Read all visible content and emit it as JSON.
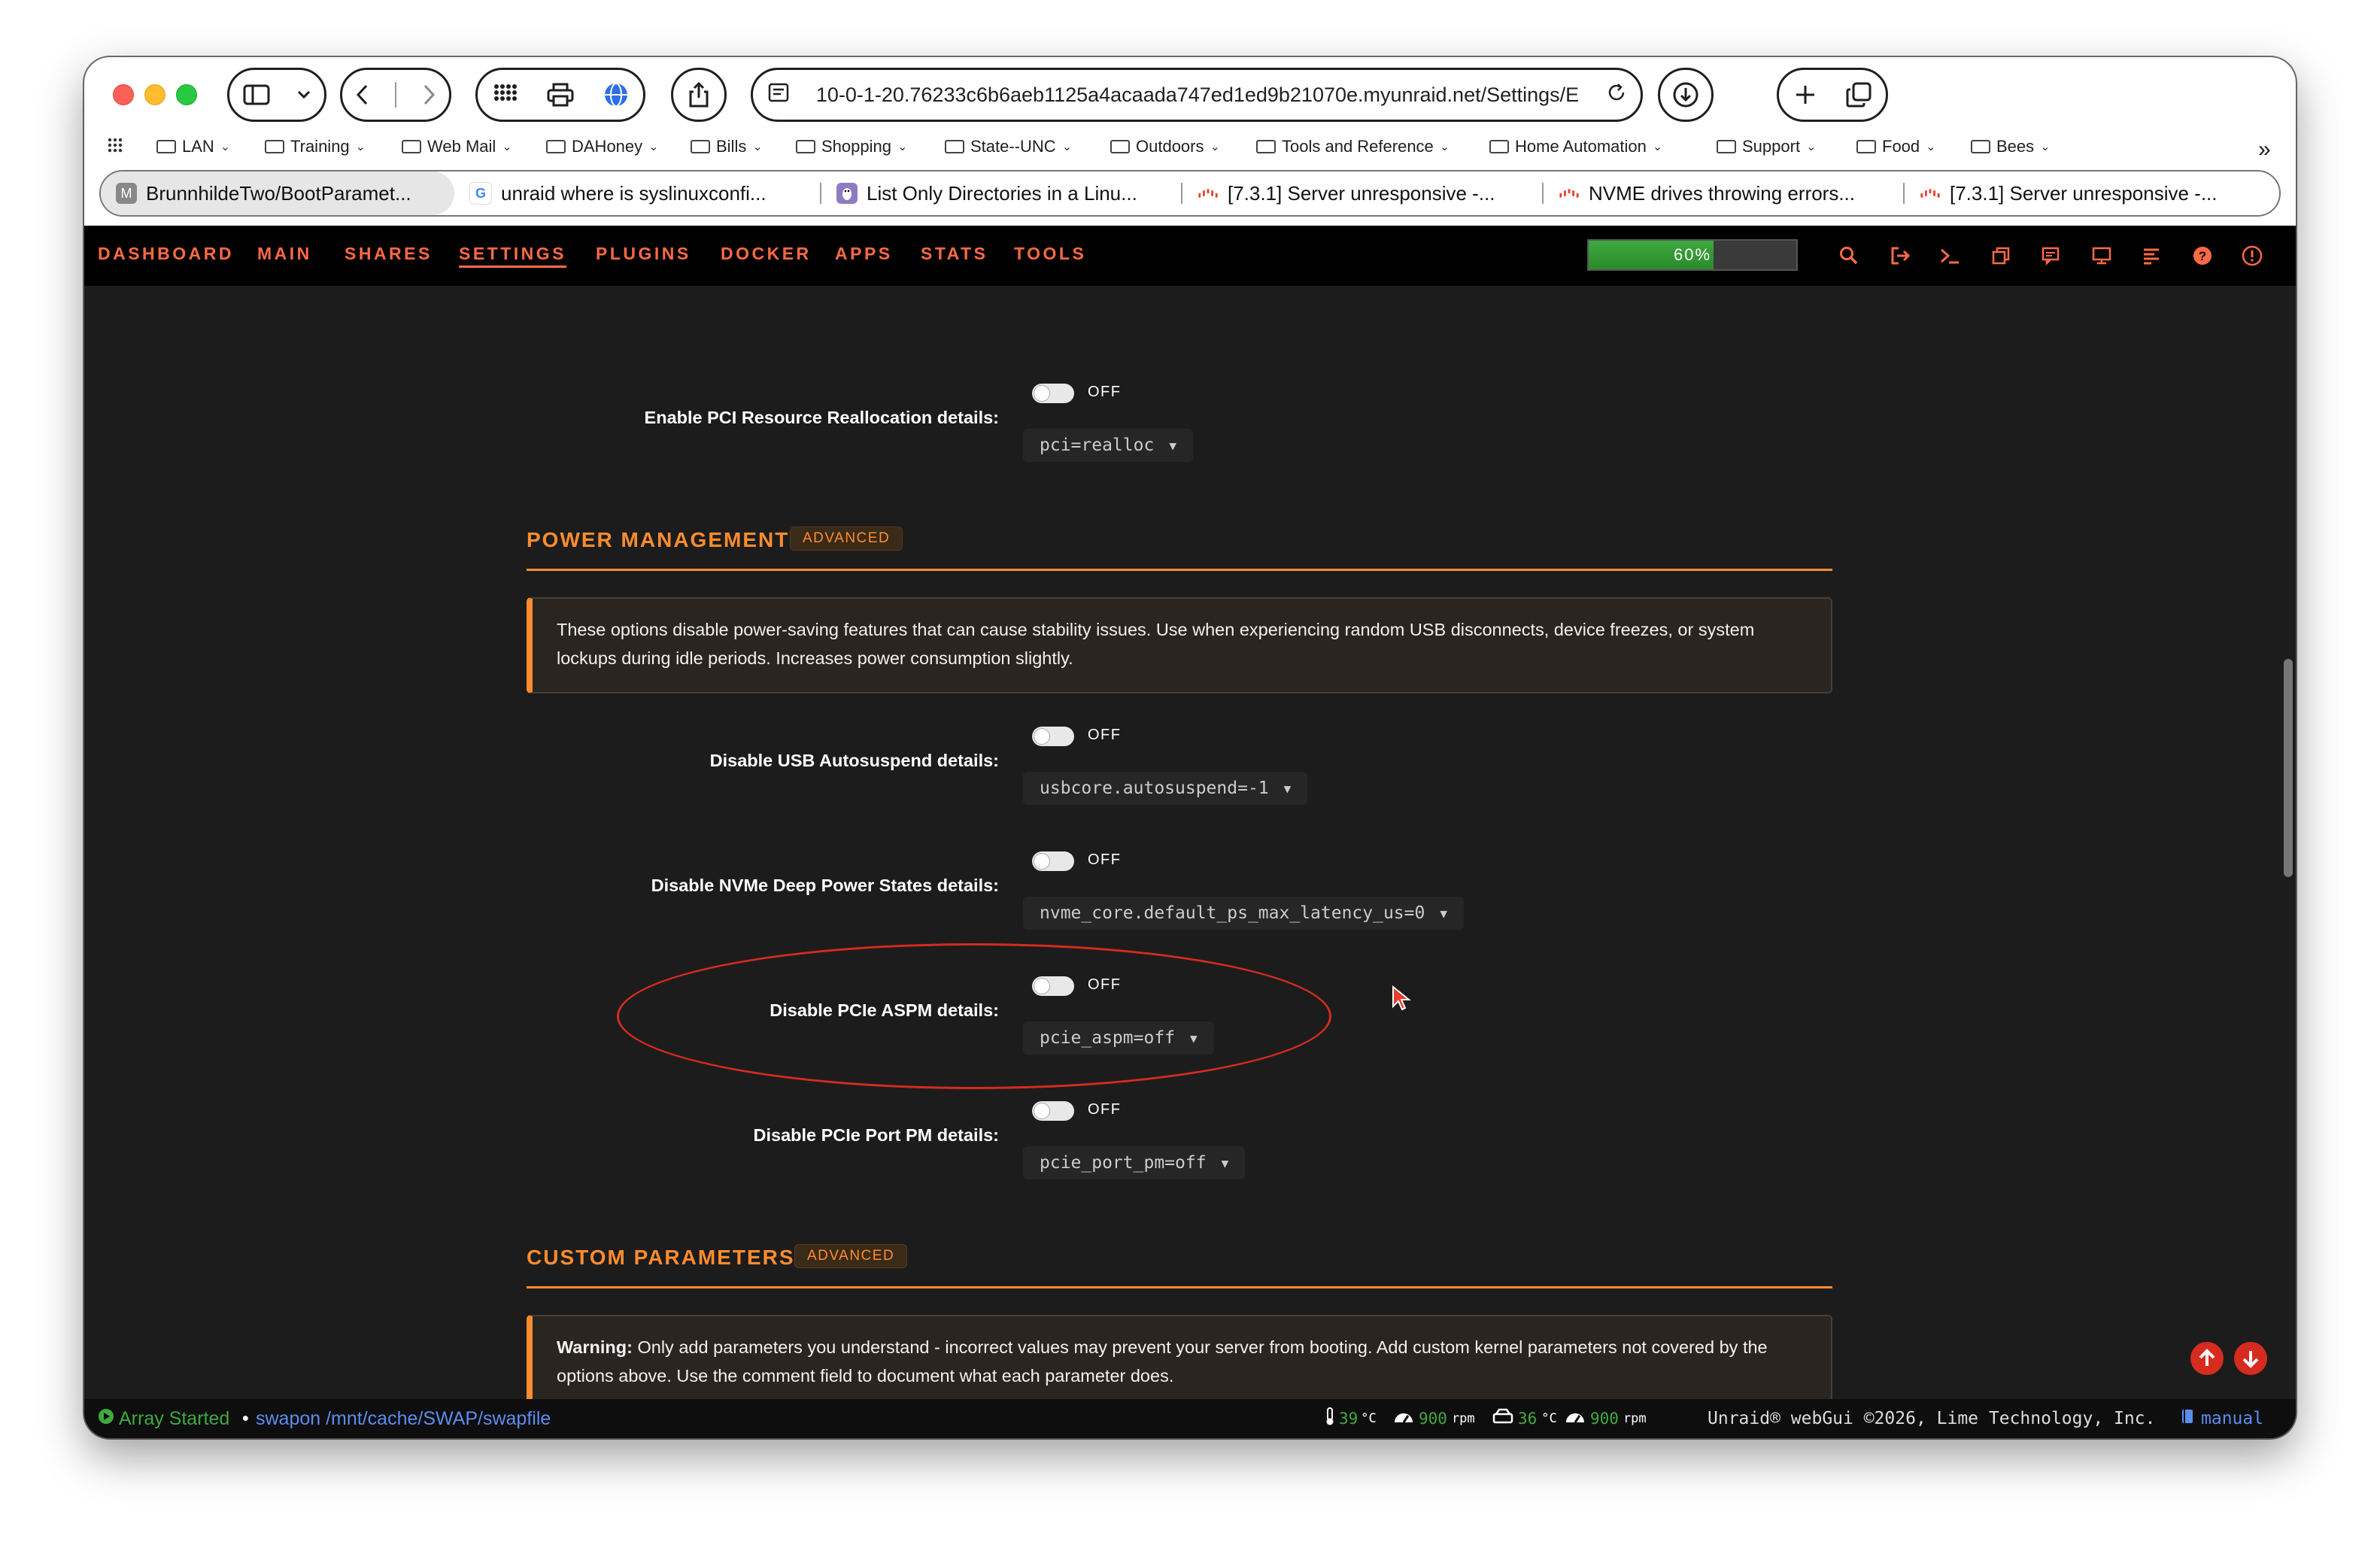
{
  "browser": {
    "url": "10-0-1-20.76233c6b6aeb1125a4acaada747ed1ed9b21070e.myunraid.net/Settings/E",
    "bookmarks": [
      {
        "label": "LAN"
      },
      {
        "label": "Training"
      },
      {
        "label": "Web Mail"
      },
      {
        "label": "DAHoney"
      },
      {
        "label": "Bills"
      },
      {
        "label": "Shopping"
      },
      {
        "label": "State--UNC"
      },
      {
        "label": "Outdoors"
      },
      {
        "label": "Tools and Reference"
      },
      {
        "label": "Home Automation"
      },
      {
        "label": "Support"
      },
      {
        "label": "Food"
      },
      {
        "label": "Bees"
      }
    ],
    "tabs": [
      {
        "title": "BrunnhildeTwo/BootParamet...",
        "favicon": "M"
      },
      {
        "title": "unraid where is syslinuxconfi...",
        "favicon": "G"
      },
      {
        "title": "List Only Directories in a Linu...",
        "favicon": "linux-icon"
      },
      {
        "title": "[7.3.1] Server unresponsive -...",
        "favicon": "unraid-icon"
      },
      {
        "title": "NVME drives throwing errors...",
        "favicon": "unraid-icon"
      },
      {
        "title": "[7.3.1] Server unresponsive -...",
        "favicon": "unraid-icon"
      }
    ]
  },
  "nav": {
    "items": [
      "DASHBOARD",
      "MAIN",
      "SHARES",
      "SETTINGS",
      "PLUGINS",
      "DOCKER",
      "APPS",
      "STATS",
      "TOOLS"
    ],
    "active": "SETTINGS",
    "progress_label": "60%",
    "progress_value": 0.6
  },
  "settings": {
    "pci_realloc": {
      "label": "Enable PCI Resource Reallocation details:",
      "state": "OFF",
      "value": "pci=realloc"
    },
    "power_management": {
      "title": "POWER MANAGEMENT",
      "badge": "ADVANCED",
      "notice": "These options disable power-saving features that can cause stability issues. Use when experiencing random USB disconnects, device freezes, or system lockups during idle periods. Increases power consumption slightly.",
      "items": [
        {
          "label": "Disable USB Autosuspend details:",
          "state": "OFF",
          "value": "usbcore.autosuspend=-1"
        },
        {
          "label": "Disable NVMe Deep Power States details:",
          "state": "OFF",
          "value": "nvme_core.default_ps_max_latency_us=0"
        },
        {
          "label": "Disable PCIe ASPM details:",
          "state": "OFF",
          "value": "pcie_aspm=off"
        },
        {
          "label": "Disable PCIe Port PM details:",
          "state": "OFF",
          "value": "pcie_port_pm=off"
        }
      ]
    },
    "custom_parameters": {
      "title": "CUSTOM PARAMETERS",
      "badge": "ADVANCED",
      "warning_label": "Warning:",
      "warning_text": "Only add parameters you understand - incorrect values may prevent your server from booting. Add custom kernel parameters not covered by the options above. Use the comment field to document what each parameter does."
    }
  },
  "footer": {
    "array_status": "Array Started",
    "swap_text": "swapon /mnt/cache/SWAP/swapfile",
    "cpu_temp": "39",
    "temp_unit": "°C",
    "fan1": "900",
    "rpm_unit": "rpm",
    "disk_temp": "36",
    "fan2": "900",
    "copyright": "Unraid® webGui ©2026, Lime Technology, Inc.",
    "manual": "manual"
  },
  "colors": {
    "accent": "#ff8c2f",
    "nav_text": "#ff6a45",
    "annotation": "#d62b1f",
    "progress": "#3fa93f",
    "link": "#5b8def"
  }
}
